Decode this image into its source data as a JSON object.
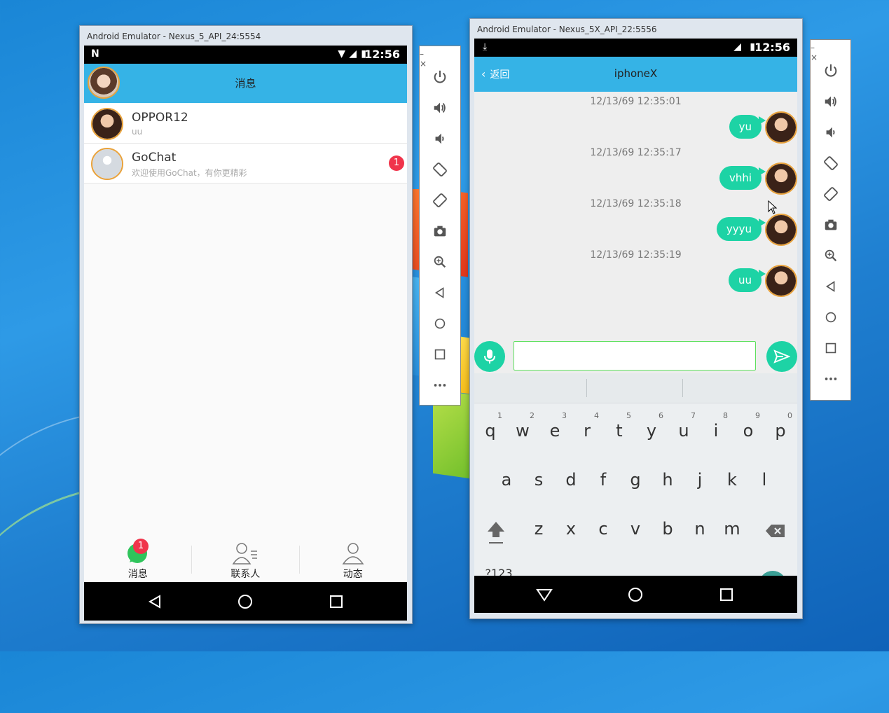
{
  "left_emulator": {
    "window_title": "Android Emulator - Nexus_5_API_24:5554",
    "status": {
      "time": "12:56"
    },
    "appbar": {
      "title": "消息"
    },
    "conversations": [
      {
        "name": "OPPOR12",
        "last_message": "uu",
        "unread": ""
      },
      {
        "name": "GoChat",
        "last_message": "欢迎使用GoChat，有你更精彩",
        "unread": "1"
      }
    ],
    "tabs": [
      {
        "label": "消息",
        "badge": "1"
      },
      {
        "label": "联系人"
      },
      {
        "label": "动态"
      }
    ]
  },
  "right_emulator": {
    "window_title": "Android Emulator - Nexus_5X_API_22:5556",
    "status": {
      "time": "12:56"
    },
    "appbar": {
      "back_label": "返回",
      "title": "iphoneX"
    },
    "messages": [
      {
        "timestamp": "12/13/69 12:35:01",
        "text": "yu"
      },
      {
        "timestamp": "12/13/69 12:35:17",
        "text": "vhhi"
      },
      {
        "timestamp": "12/13/69 12:35:18",
        "text": "yyyu"
      },
      {
        "timestamp": "12/13/69 12:35:19",
        "text": "uu"
      }
    ],
    "input": {
      "value": ""
    },
    "keyboard": {
      "row1": [
        {
          "k": "q",
          "h": "1"
        },
        {
          "k": "w",
          "h": "2"
        },
        {
          "k": "e",
          "h": "3"
        },
        {
          "k": "r",
          "h": "4"
        },
        {
          "k": "t",
          "h": "5"
        },
        {
          "k": "y",
          "h": "6"
        },
        {
          "k": "u",
          "h": "7"
        },
        {
          "k": "i",
          "h": "8"
        },
        {
          "k": "o",
          "h": "9"
        },
        {
          "k": "p",
          "h": "0"
        }
      ],
      "row2": [
        "a",
        "s",
        "d",
        "f",
        "g",
        "h",
        "j",
        "k",
        "l"
      ],
      "row3": [
        "z",
        "x",
        "c",
        "v",
        "b",
        "n",
        "m"
      ],
      "symbols_label": "?123",
      "comma": ",",
      "period": "."
    }
  },
  "sidebar_controls": {
    "window_buttons": "– ×",
    "buttons": [
      "power-icon",
      "volume-up-icon",
      "volume-down-icon",
      "rotate-left-icon",
      "rotate-right-icon",
      "camera-icon",
      "zoom-icon",
      "back-icon",
      "home-icon",
      "overview-icon",
      "more-icon"
    ]
  },
  "colors": {
    "appbar": "#35b3e6",
    "bubble": "#1dd3a5",
    "badge": "#f0344b",
    "avatar_border": "#e9a23b"
  }
}
